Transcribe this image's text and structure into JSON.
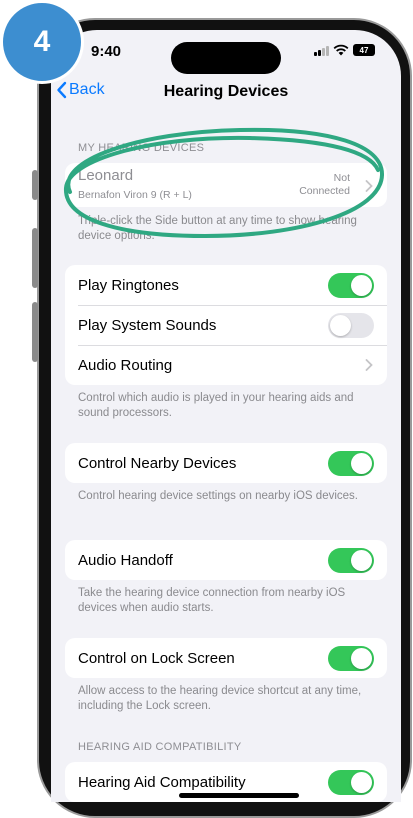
{
  "step_badge": "4",
  "status": {
    "time": "9:40",
    "battery": "47"
  },
  "nav": {
    "back_label": "Back",
    "title": "Hearing Devices"
  },
  "my_devices": {
    "header": "MY HEARING DEVICES",
    "device_name": "Leonard",
    "device_model": "Bernafon Viron 9 (R + L)",
    "status_line1": "Not",
    "status_line2": "Connected",
    "footer": "Triple-click the Side button at any time to show hearing device options."
  },
  "audio_group": {
    "play_ringtones": {
      "label": "Play Ringtones",
      "on": true
    },
    "play_system_sounds": {
      "label": "Play System Sounds",
      "on": false
    },
    "audio_routing": {
      "label": "Audio Routing"
    },
    "footer": "Control which audio is played in your hearing aids and sound processors."
  },
  "control_nearby": {
    "label": "Control Nearby Devices",
    "on": true,
    "footer": "Control hearing device settings on nearby iOS devices."
  },
  "audio_handoff": {
    "label": "Audio Handoff",
    "on": true,
    "footer": "Take the hearing device connection from nearby iOS devices when audio starts."
  },
  "lock_screen": {
    "label": "Control on Lock Screen",
    "on": true,
    "footer": "Allow access to the hearing device shortcut at any time, including the Lock screen."
  },
  "compat": {
    "header": "HEARING AID COMPATIBILITY",
    "label": "Hearing Aid Compatibility",
    "on": true
  },
  "colors": {
    "accent": "#0a7aff",
    "toggle_on": "#34c759",
    "highlight_ellipse": "#2fa882",
    "badge": "#3d8ed0"
  }
}
